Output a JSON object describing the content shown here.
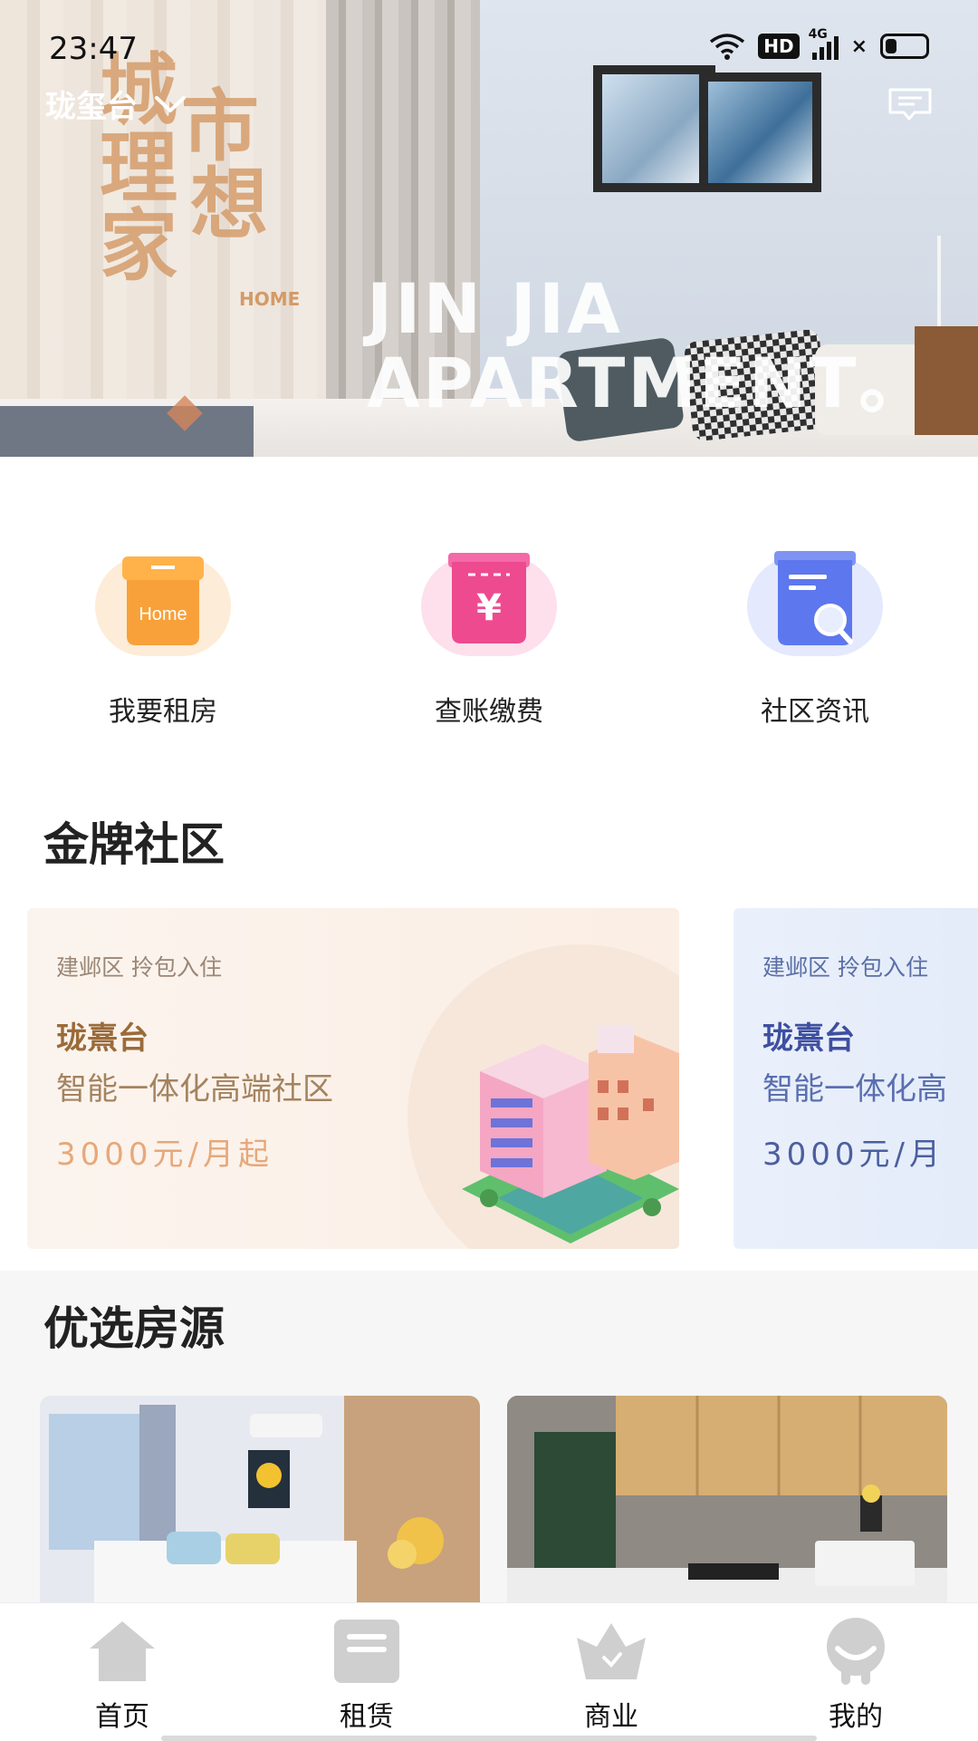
{
  "status_bar": {
    "time": "23:47",
    "network_badge": "HD",
    "network_type": "4G",
    "icons": [
      "wifi-icon",
      "hd-icon",
      "signal-icon",
      "no-sim-icon",
      "battery-icon"
    ]
  },
  "header": {
    "location": "珑玺台",
    "location_icon": "chevron-down-icon",
    "message_icon": "message-icon"
  },
  "banner": {
    "slogan_cn": [
      "城",
      "市",
      "理",
      "想",
      "家"
    ],
    "slogan_small": "HOME",
    "slogan_en": [
      "JIN JIA",
      "APARTMENT。"
    ]
  },
  "quick_actions": [
    {
      "label": "我要租房",
      "icon": "house-box-icon",
      "icon_text": "Home",
      "color": "#f7a23c"
    },
    {
      "label": "查账缴费",
      "icon": "bill-icon",
      "icon_text": "¥",
      "color": "#ef4c91"
    },
    {
      "label": "社区资讯",
      "icon": "news-search-icon",
      "icon_text": "",
      "color": "#5a74ec"
    }
  ],
  "gold_community": {
    "title": "金牌社区",
    "cards": [
      {
        "tag": "建邺区 拎包入住",
        "name": "珑熹台",
        "desc": "智能一体化高端社区",
        "price": "3000元/月起"
      },
      {
        "tag": "建邺区 拎包入住",
        "name": "珑熹台",
        "desc": "智能一体化高",
        "price": "3000元/月"
      }
    ]
  },
  "preferred": {
    "title": "优选房源"
  },
  "tabbar": {
    "items": [
      {
        "label": "首页",
        "icon": "home-icon"
      },
      {
        "label": "租赁",
        "icon": "lease-icon"
      },
      {
        "label": "商业",
        "icon": "business-icon"
      },
      {
        "label": "我的",
        "icon": "profile-icon"
      }
    ]
  },
  "colors": {
    "accent_orange": "#f7a23c",
    "accent_pink": "#ef4c91",
    "accent_blue": "#5a74ec",
    "tab_inactive": "#c9c9c9"
  }
}
